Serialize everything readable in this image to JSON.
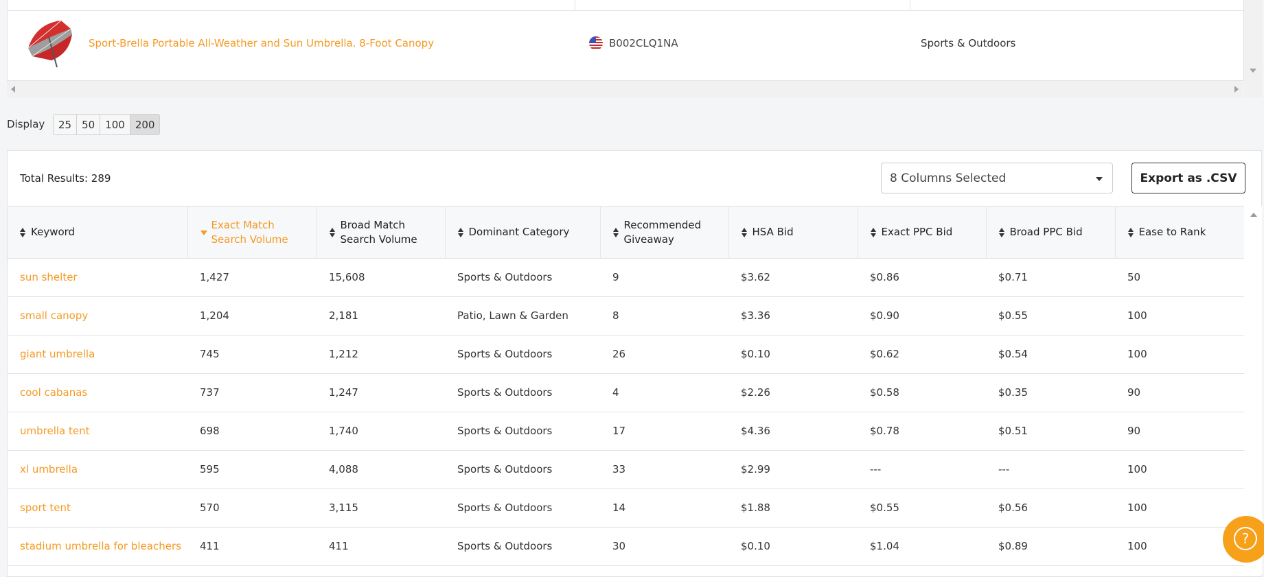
{
  "product": {
    "title": "Sport-Brella Portable All-Weather and Sun Umbrella. 8-Foot Canopy",
    "asin": "B002CLQ1NA",
    "category": "Sports & Outdoors",
    "flag_icon": "us-flag-icon",
    "image_icon": "umbrella-product-image"
  },
  "display": {
    "label": "Display",
    "options": [
      "25",
      "50",
      "100",
      "200"
    ],
    "selected": "200"
  },
  "results": {
    "total_label": "Total Results: 289",
    "columns_select": "8 Columns Selected",
    "export_label": "Export as .CSV"
  },
  "table": {
    "headers": [
      "Keyword",
      "Exact Match Search Volume",
      "Broad Match Search Volume",
      "Dominant Category",
      "Recommended Giveaway",
      "HSA Bid",
      "Exact PPC Bid",
      "Broad PPC Bid",
      "Ease to Rank"
    ],
    "sorted_column": "Exact Match Search Volume",
    "rows": [
      [
        "sun shelter",
        "1,427",
        "15,608",
        "Sports & Outdoors",
        "9",
        "$3.62",
        "$0.86",
        "$0.71",
        "50"
      ],
      [
        "small canopy",
        "1,204",
        "2,181",
        "Patio, Lawn & Garden",
        "8",
        "$3.36",
        "$0.90",
        "$0.55",
        "100"
      ],
      [
        "giant umbrella",
        "745",
        "1,212",
        "Sports & Outdoors",
        "26",
        "$0.10",
        "$0.62",
        "$0.54",
        "100"
      ],
      [
        "cool cabanas",
        "737",
        "1,247",
        "Sports & Outdoors",
        "4",
        "$2.26",
        "$0.58",
        "$0.35",
        "90"
      ],
      [
        "umbrella tent",
        "698",
        "1,740",
        "Sports & Outdoors",
        "17",
        "$4.36",
        "$0.78",
        "$0.51",
        "90"
      ],
      [
        "xl umbrella",
        "595",
        "4,088",
        "Sports & Outdoors",
        "33",
        "$2.99",
        "---",
        "---",
        "100"
      ],
      [
        "sport tent",
        "570",
        "3,115",
        "Sports & Outdoors",
        "14",
        "$1.88",
        "$0.55",
        "$0.56",
        "100"
      ],
      [
        "stadium umbrella for bleachers",
        "411",
        "411",
        "Sports & Outdoors",
        "30",
        "$0.10",
        "$1.04",
        "$0.89",
        "100"
      ]
    ]
  },
  "help": {
    "glyph": "?"
  },
  "colors": {
    "accent": "#f59a23",
    "border": "#e1e1e1",
    "header_bg": "#f7f8fa"
  }
}
